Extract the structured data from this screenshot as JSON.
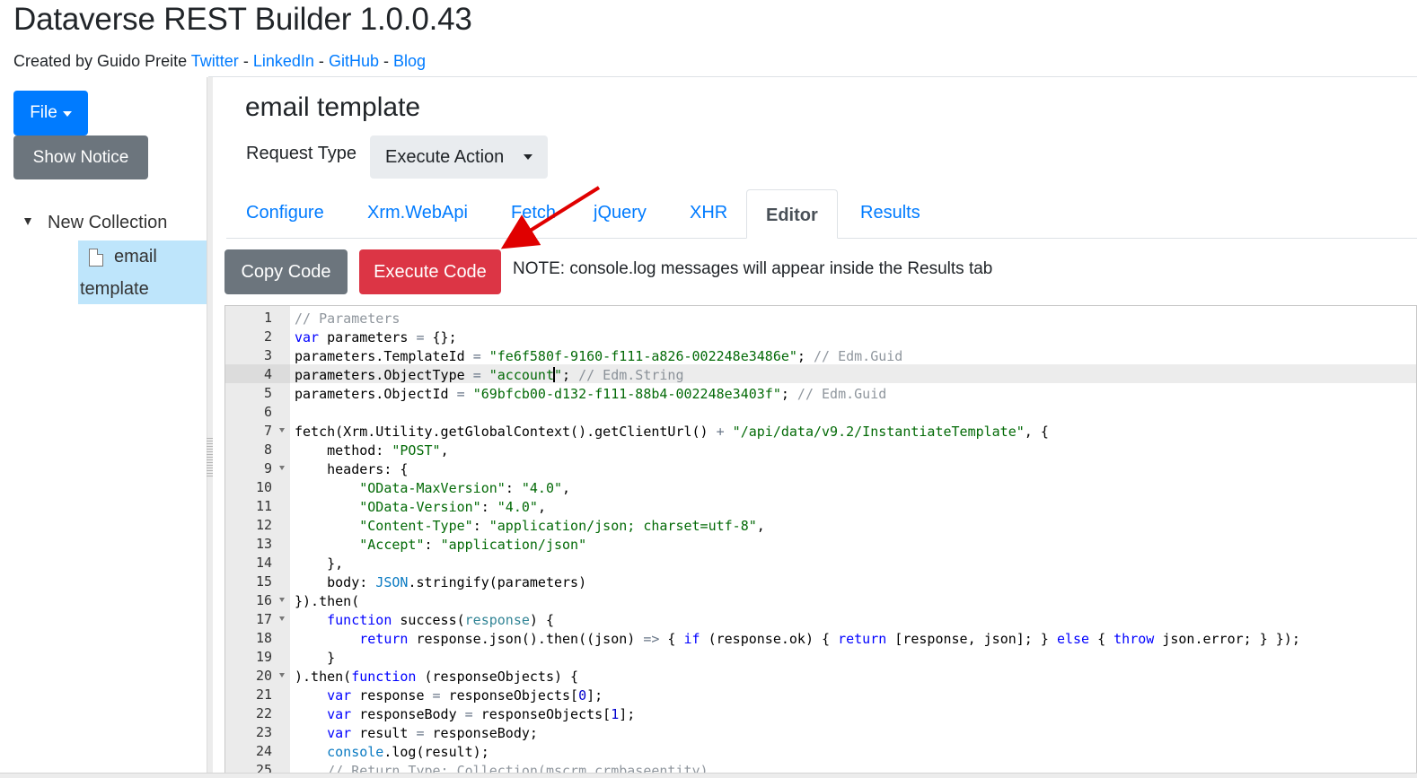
{
  "app": {
    "title": "Dataverse REST Builder 1.0.0.43",
    "credits_prefix": "Created by Guido Preite",
    "links": [
      "Twitter",
      "LinkedIn",
      "GitHub",
      "Blog"
    ],
    "link_separator": "-"
  },
  "sidebar": {
    "file_button": "File",
    "notice_button": "Show Notice",
    "tree": {
      "root_label": "New Collection",
      "node_line1": "email",
      "node_line2": "template"
    }
  },
  "request": {
    "name": "email template",
    "type_label": "Request Type",
    "type_value": "Execute Action"
  },
  "tabs": [
    {
      "label": "Configure",
      "active": false
    },
    {
      "label": "Xrm.WebApi",
      "active": false
    },
    {
      "label": "Fetch",
      "active": false
    },
    {
      "label": "jQuery",
      "active": false
    },
    {
      "label": "XHR",
      "active": false
    },
    {
      "label": "Editor",
      "active": true
    },
    {
      "label": "Results",
      "active": false
    }
  ],
  "toolbar": {
    "copy_label": "Copy Code",
    "execute_label": "Execute Code",
    "note": "NOTE: console.log messages will appear inside the Results tab"
  },
  "editor": {
    "active_line": 4,
    "fold_lines": [
      7,
      9,
      16,
      17,
      20
    ],
    "lines": [
      "// Parameters",
      "var parameters = {};",
      "parameters.TemplateId = \"fe6f580f-9160-f111-a826-002248e3486e\"; // Edm.Guid",
      "parameters.ObjectType = \"account\"; // Edm.String",
      "parameters.ObjectId = \"69bfcb00-d132-f111-88b4-002248e3403f\"; // Edm.Guid",
      "",
      "fetch(Xrm.Utility.getGlobalContext().getClientUrl() + \"/api/data/v9.2/InstantiateTemplate\", {",
      "    method: \"POST\",",
      "    headers: {",
      "        \"OData-MaxVersion\": \"4.0\",",
      "        \"OData-Version\": \"4.0\",",
      "        \"Content-Type\": \"application/json; charset=utf-8\",",
      "        \"Accept\": \"application/json\"",
      "    },",
      "    body: JSON.stringify(parameters)",
      "}).then(",
      "    function success(response) {",
      "        return response.json().then((json) => { if (response.ok) { return [response, json]; } else { throw json.error; } });",
      "    }",
      ").then(function (responseObjects) {",
      "    var response = responseObjects[0];",
      "    var responseBody = responseObjects[1];",
      "    var result = responseBody;",
      "    console.log(result);",
      "    // Return Type: Collection(mscrm.crmbaseentity)"
    ]
  },
  "colors": {
    "primary": "#007bff",
    "secondary": "#6c757d",
    "danger": "#dc3545",
    "tree_selected": "#bee5fb",
    "annotation_arrow": "#e00000"
  }
}
